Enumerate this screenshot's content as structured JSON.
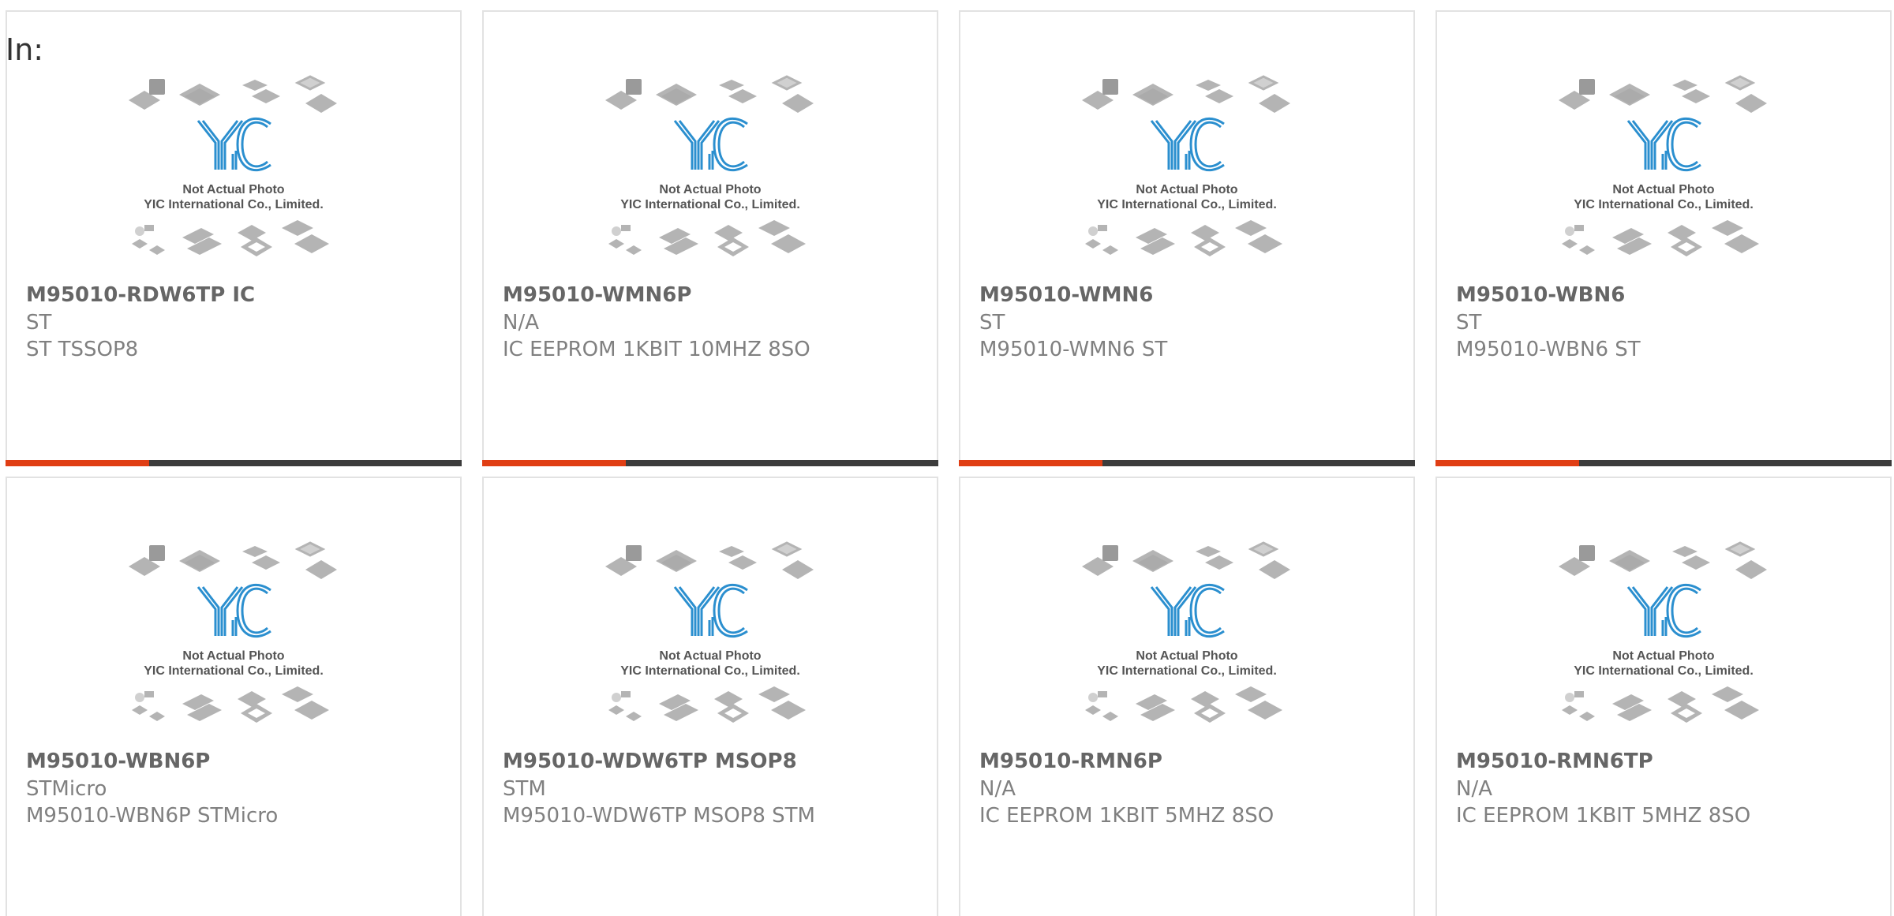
{
  "in_label": "In:",
  "placeholder": {
    "line1": "Not Actual Photo",
    "line2": "YIC International Co., Limited.",
    "logo_text": "YIC",
    "logo_color": "#2b8fcf"
  },
  "colors": {
    "accent": "#e03e14",
    "bar": "#3c3c3c",
    "border": "#e2e2e2"
  },
  "products": [
    {
      "part": "M95010-RDW6TP IC",
      "manufacturer": "ST",
      "description": "ST TSSOP8"
    },
    {
      "part": "M95010-WMN6P",
      "manufacturer": "N/A",
      "description": "IC EEPROM 1KBIT 10MHZ 8SO"
    },
    {
      "part": "M95010-WMN6",
      "manufacturer": "ST",
      "description": "M95010-WMN6 ST"
    },
    {
      "part": "M95010-WBN6",
      "manufacturer": "ST",
      "description": "M95010-WBN6 ST"
    },
    {
      "part": "M95010-WBN6P",
      "manufacturer": "STMicro",
      "description": "M95010-WBN6P STMicro"
    },
    {
      "part": "M95010-WDW6TP MSOP8",
      "manufacturer": "STM",
      "description": "M95010-WDW6TP MSOP8 STM"
    },
    {
      "part": "M95010-RMN6P",
      "manufacturer": "N/A",
      "description": "IC EEPROM 1KBIT 5MHZ 8SO"
    },
    {
      "part": "M95010-RMN6TP",
      "manufacturer": "N/A",
      "description": "IC EEPROM 1KBIT 5MHZ 8SO"
    }
  ]
}
